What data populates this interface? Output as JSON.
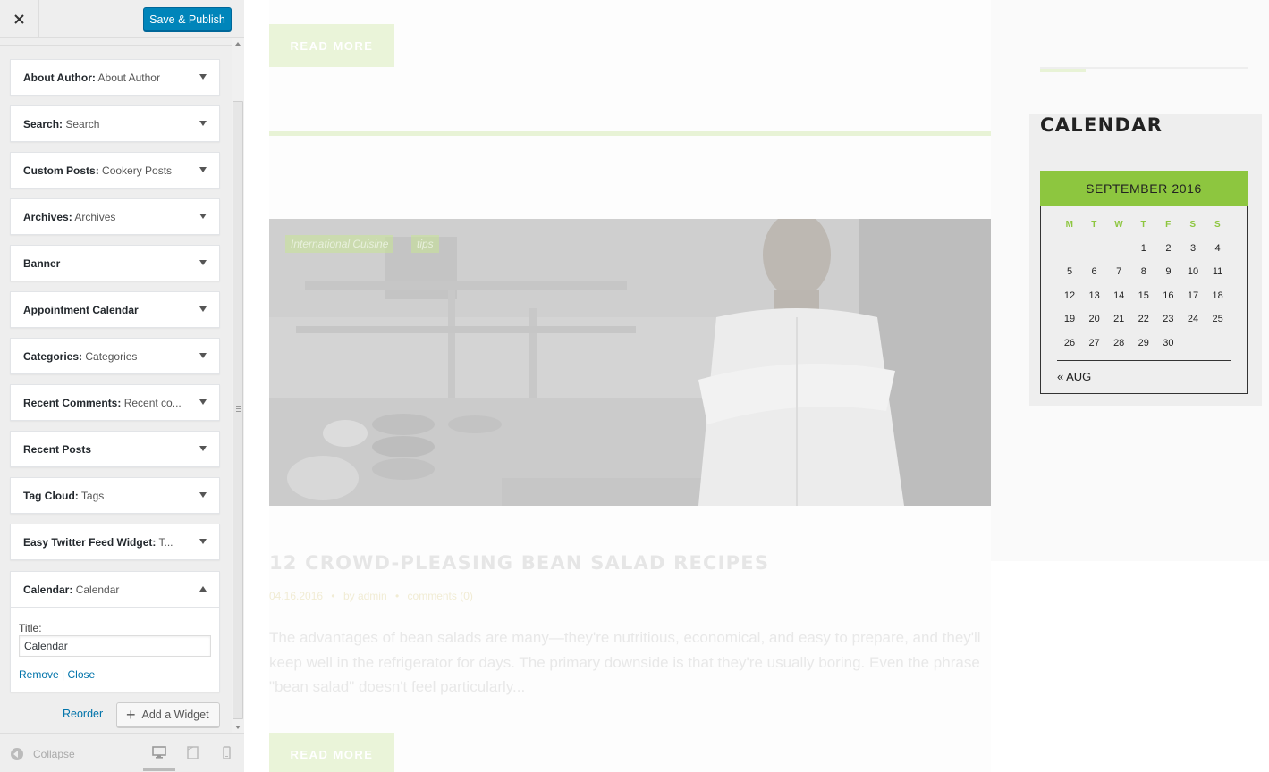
{
  "customizer": {
    "save_label": "Save & Publish",
    "widgets": [
      {
        "type": "About Author",
        "instance": "About Author"
      },
      {
        "type": "Search",
        "instance": "Search"
      },
      {
        "type": "Custom Posts",
        "instance": "Cookery Posts"
      },
      {
        "type": "Archives",
        "instance": "Archives"
      },
      {
        "type": "Banner",
        "instance": ""
      },
      {
        "type": "Appointment Calendar",
        "instance": ""
      },
      {
        "type": "Categories",
        "instance": "Categories"
      },
      {
        "type": "Recent Comments",
        "instance": "Recent co..."
      },
      {
        "type": "Recent Posts",
        "instance": ""
      },
      {
        "type": "Tag Cloud",
        "instance": "Tags"
      },
      {
        "type": "Easy Twitter Feed Widget",
        "instance": "T..."
      }
    ],
    "calendar_widget": {
      "type": "Calendar",
      "instance": "Calendar",
      "title_label": "Title:",
      "title_value": "Calendar",
      "remove_label": "Remove",
      "separator": "|",
      "close_label": "Close"
    },
    "reorder_label": "Reorder",
    "add_widget_label": "Add a Widget",
    "collapse_label": "Collapse"
  },
  "preview": {
    "read_more_label": "READ MORE",
    "post": {
      "categories": [
        "International Cuisine",
        "tips"
      ],
      "title": "12 CROWD-PLEASING BEAN SALAD RECIPES",
      "date": "04.16.2016",
      "author": "by admin",
      "comments": "comments (0)",
      "bullet": "•",
      "excerpt": "The advantages of bean salads are many—they're nutritious, economical, and easy to prepare, and they'll keep well in the refrigerator for days. The primary downside is that they're usually boring. Even the phrase \"bean salad\" doesn't feel particularly..."
    },
    "calendar": {
      "heading": "CALENDAR",
      "caption": "SEPTEMBER 2016",
      "weekdays": [
        "M",
        "T",
        "W",
        "T",
        "F",
        "S",
        "S"
      ],
      "weeks": [
        [
          "",
          "",
          "",
          "1",
          "2",
          "3",
          "4"
        ],
        [
          "5",
          "6",
          "7",
          "8",
          "9",
          "10",
          "11"
        ],
        [
          "12",
          "13",
          "14",
          "15",
          "16",
          "17",
          "18"
        ],
        [
          "19",
          "20",
          "21",
          "22",
          "23",
          "24",
          "25"
        ],
        [
          "26",
          "27",
          "28",
          "29",
          "30",
          "",
          ""
        ]
      ],
      "prev_link": "« AUG"
    }
  },
  "colors": {
    "accent_blue": "#0085ba",
    "calendar_green": "#8dc63f",
    "link_blue": "#0073aa"
  }
}
